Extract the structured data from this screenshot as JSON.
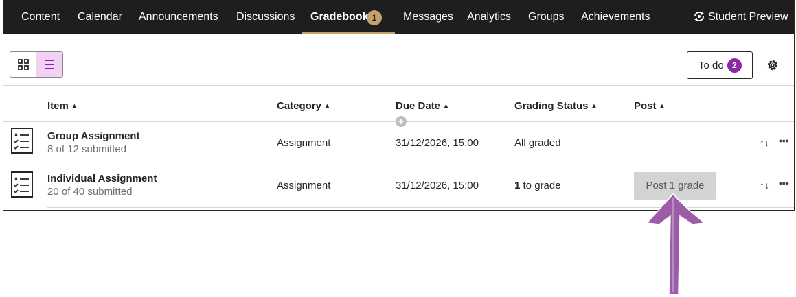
{
  "nav": {
    "items": [
      {
        "label": "Content"
      },
      {
        "label": "Calendar"
      },
      {
        "label": "Announcements"
      },
      {
        "label": "Discussions"
      },
      {
        "label": "Gradebook",
        "badge": "1",
        "active": true
      },
      {
        "label": "Messages"
      },
      {
        "label": "Analytics"
      },
      {
        "label": "Groups"
      },
      {
        "label": "Achievements"
      }
    ],
    "student_preview": "Student Preview"
  },
  "toolbar": {
    "todo_label": "To do",
    "todo_count": "2",
    "view_grid_icon": "grid-icon",
    "view_list_icon": "list-icon",
    "settings_icon": "gear-icon"
  },
  "table": {
    "columns": [
      "Item",
      "Category",
      "Due Date",
      "Grading Status",
      "Post"
    ],
    "rows": [
      {
        "title": "Group Assignment",
        "submitted": "8 of 12 submitted",
        "category": "Assignment",
        "due": "31/12/2026, 15:00",
        "status": "All graded",
        "post": ""
      },
      {
        "title": "Individual Assignment",
        "submitted": "20 of 40 submitted",
        "category": "Assignment",
        "due": "31/12/2026, 15:00",
        "status_count": "1",
        "status_text": " to grade",
        "post": "Post 1 grade"
      }
    ]
  },
  "colors": {
    "nav_bg": "#1e1e1e",
    "accent_gold": "#c5a06b",
    "accent_purple": "#8e29a6",
    "list_toggle_bg": "#f1d2f5",
    "annotation_arrow": "#9b5ca8"
  }
}
